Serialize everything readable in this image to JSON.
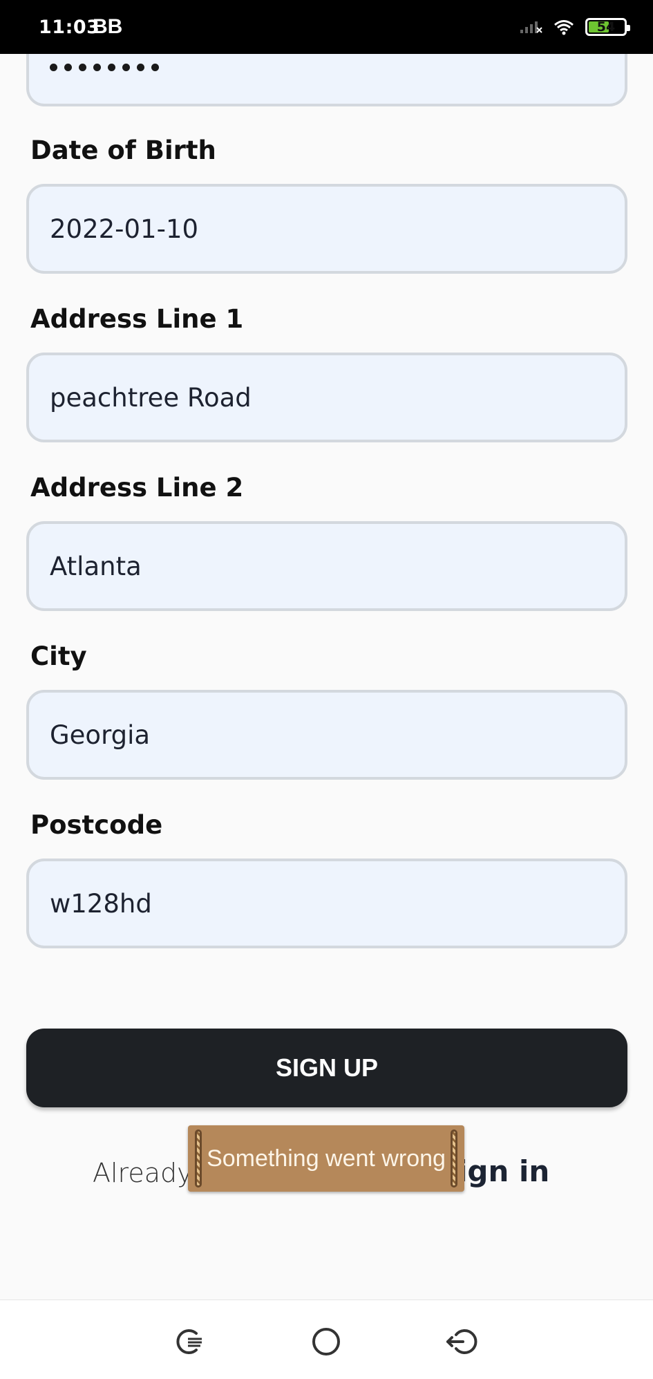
{
  "status_bar": {
    "time": "11:03",
    "carrier_icon": "BB",
    "battery": "54",
    "icons": [
      "signal-icon",
      "wifi-icon",
      "battery-icon"
    ]
  },
  "form": {
    "password_mask": "••••••••",
    "fields": [
      {
        "label": "Date of Birth",
        "value": "2022-01-10"
      },
      {
        "label": "Address Line 1",
        "value": "peachtree Road"
      },
      {
        "label": "Address Line 2",
        "value": "Atlanta"
      },
      {
        "label": "City",
        "value": "Georgia"
      },
      {
        "label": "Postcode",
        "value": "w128hd"
      }
    ],
    "submit_label": "SIGN UP"
  },
  "footer": {
    "already_text": "Already",
    "signin_text": "ign in"
  },
  "toast": {
    "message": "Something went wrong"
  },
  "nav": {
    "icons": [
      "recents-icon",
      "home-icon",
      "back-icon"
    ]
  },
  "colors": {
    "field_bg": "#eef4fd",
    "field_border": "#d3d8de",
    "button_bg": "#1e2125",
    "toast_bg": "#b5885a"
  }
}
